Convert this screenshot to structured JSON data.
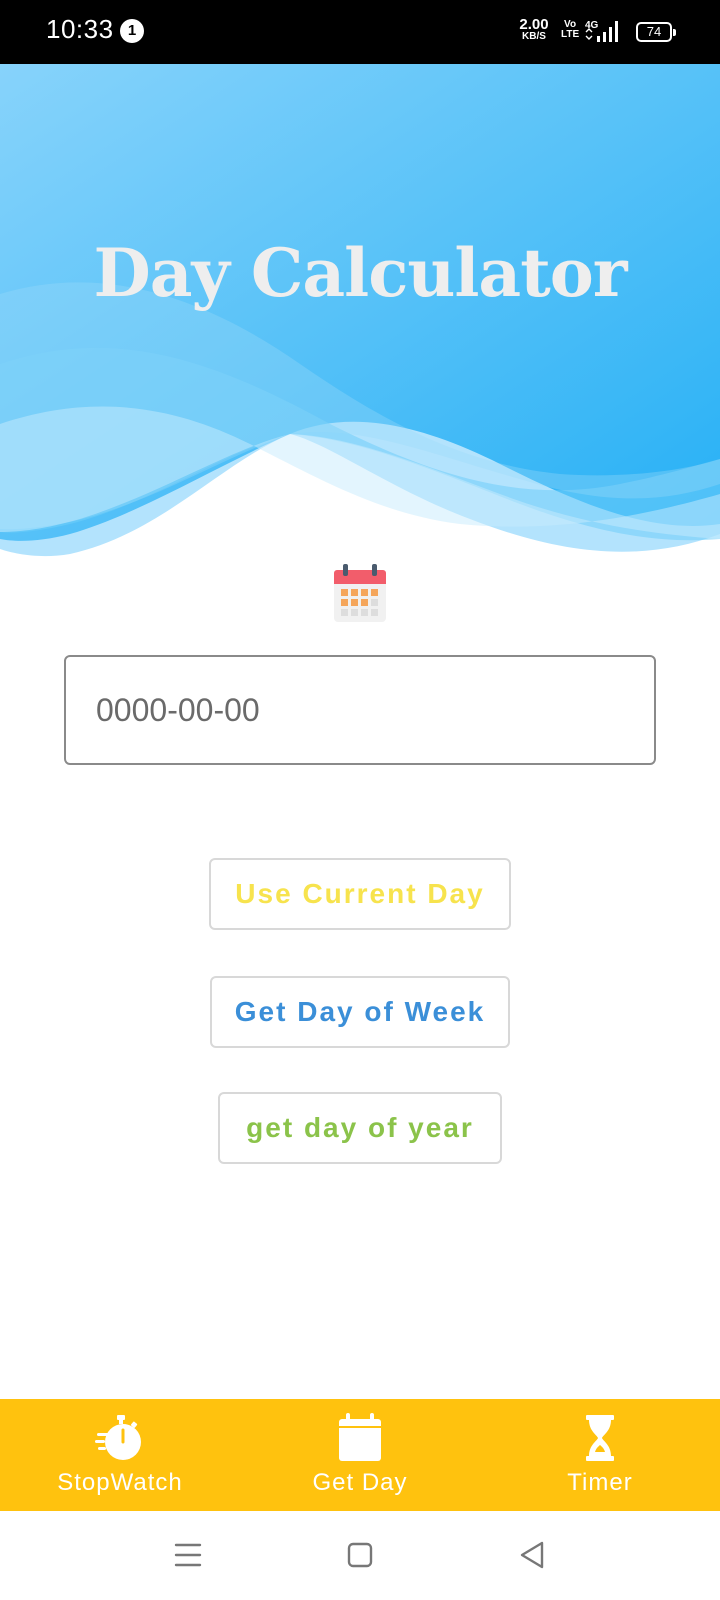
{
  "status_bar": {
    "time": "10:33",
    "notification_count": "1",
    "net_speed_value": "2.00",
    "net_speed_unit": "KB/S",
    "volte_top": "Vo",
    "volte_bottom": "LTE",
    "network_type": "4G",
    "battery_level": "74"
  },
  "header": {
    "title": "Day Calculator",
    "gradient_start": "#87d3fb",
    "gradient_end": "#26b0f5"
  },
  "date_input": {
    "placeholder": "0000-00-00",
    "value": ""
  },
  "buttons": {
    "use_current_day": "Use Current Day",
    "get_day_of_week": "Get Day of Week",
    "get_day_of_year": "get day of year"
  },
  "bottom_nav": {
    "background": "#ffc20e",
    "items": [
      {
        "label": "StopWatch",
        "icon": "stopwatch-icon"
      },
      {
        "label": "Get Day",
        "icon": "calendar-icon"
      },
      {
        "label": "Timer",
        "icon": "hourglass-icon"
      }
    ]
  },
  "colors": {
    "use_current_day": "#f7e34d",
    "get_day_of_week": "#3b8fd8",
    "get_day_of_year": "#8bc34a"
  }
}
